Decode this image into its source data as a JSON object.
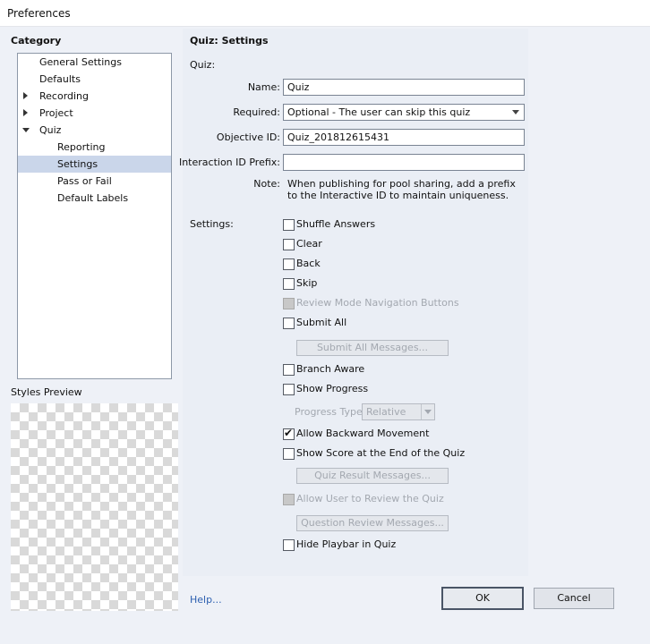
{
  "window": {
    "title": "Preferences"
  },
  "category": {
    "heading": "Category",
    "items": [
      {
        "label": "General Settings",
        "level": 0,
        "expander": "none",
        "selected": false
      },
      {
        "label": "Defaults",
        "level": 0,
        "expander": "none",
        "selected": false
      },
      {
        "label": "Recording",
        "level": 0,
        "expander": "collapsed",
        "selected": false
      },
      {
        "label": "Project",
        "level": 0,
        "expander": "collapsed",
        "selected": false
      },
      {
        "label": "Quiz",
        "level": 0,
        "expander": "expanded",
        "selected": false
      },
      {
        "label": "Reporting",
        "level": 1,
        "expander": "none",
        "selected": false
      },
      {
        "label": "Settings",
        "level": 1,
        "expander": "none",
        "selected": true
      },
      {
        "label": "Pass or Fail",
        "level": 1,
        "expander": "none",
        "selected": false
      },
      {
        "label": "Default Labels",
        "level": 1,
        "expander": "none",
        "selected": false
      }
    ],
    "styles_preview_label": "Styles Preview"
  },
  "panel": {
    "heading": "Quiz: Settings",
    "quiz_section": "Quiz:",
    "name_label": "Name:",
    "name_value": "Quiz",
    "required_label": "Required:",
    "required_value": "Optional - The user can skip this quiz",
    "objective_label": "Objective ID:",
    "objective_value": "Quiz_201812615431",
    "interaction_label": "Interaction ID Prefix:",
    "interaction_value": "",
    "note_label": "Note:",
    "note_line1": "When publishing for pool sharing, add a prefix",
    "note_line2": "to the Interactive ID to maintain uniqueness.",
    "settings_label": "Settings:",
    "checkboxes": {
      "shuffle": {
        "label": "Shuffle Answers",
        "checked": false,
        "disabled": false
      },
      "clear": {
        "label": "Clear",
        "checked": false,
        "disabled": false
      },
      "back": {
        "label": "Back",
        "checked": false,
        "disabled": false
      },
      "skip": {
        "label": "Skip",
        "checked": false,
        "disabled": false
      },
      "review_nav": {
        "label": "Review Mode Navigation Buttons",
        "checked": false,
        "disabled": true
      },
      "submit_all": {
        "label": "Submit All",
        "checked": false,
        "disabled": false
      },
      "branch_aware": {
        "label": "Branch Aware",
        "checked": false,
        "disabled": false
      },
      "show_progress": {
        "label": "Show Progress",
        "checked": false,
        "disabled": false
      },
      "allow_backward": {
        "label": "Allow Backward Movement",
        "checked": true,
        "disabled": false
      },
      "show_score": {
        "label": "Show Score at the End of the Quiz",
        "checked": false,
        "disabled": false
      },
      "allow_review": {
        "label": "Allow User to Review the Quiz",
        "checked": false,
        "disabled": true
      },
      "hide_playbar": {
        "label": "Hide Playbar in Quiz",
        "checked": false,
        "disabled": false
      }
    },
    "submit_all_messages_btn": "Submit All Messages...",
    "progress_type_label": "Progress Type:",
    "progress_type_value": "Relative",
    "quiz_result_messages_btn": "Quiz Result Messages...",
    "question_review_messages_btn": "Question Review Messages..."
  },
  "footer": {
    "help_link": "Help...",
    "ok_label": "OK",
    "cancel_label": "Cancel"
  },
  "colors": {
    "background": "#eef1f7",
    "selection": "#cad6ea",
    "link": "#2c5fb0",
    "disabled_text": "#a3a8b0"
  }
}
